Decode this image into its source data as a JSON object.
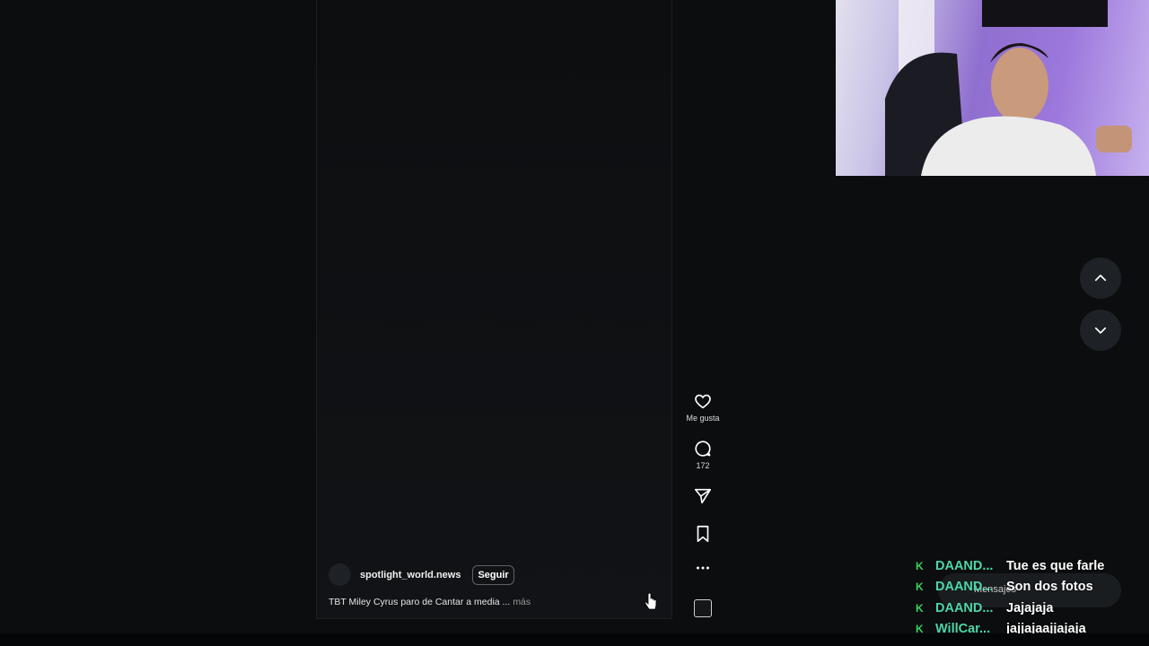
{
  "post": {
    "username": "spotlight_world.news",
    "follow_label": "Seguir",
    "caption": "TBT Miley Cyrus paro de Cantar a media ...",
    "more_label": "más"
  },
  "actions": {
    "like_label": "Me gusta",
    "comment_count": "172"
  },
  "messages_label": "Mensajes",
  "chat": [
    {
      "badge": "K",
      "user": "DAAND...",
      "message": "Tue es que farle"
    },
    {
      "badge": "K",
      "user": "DAAND...",
      "message": "Son dos fotos"
    },
    {
      "badge": "K",
      "user": "DAAND...",
      "message": "Jajajaja"
    },
    {
      "badge": "K",
      "user": "WillCar...",
      "message": "jajjajaajjajaja"
    }
  ],
  "colors": {
    "background": "#0b0d0f",
    "chat_badge": "#3ecf5a",
    "chat_user": "#4dd6a6",
    "webcam_wall": "#9c78dc"
  }
}
